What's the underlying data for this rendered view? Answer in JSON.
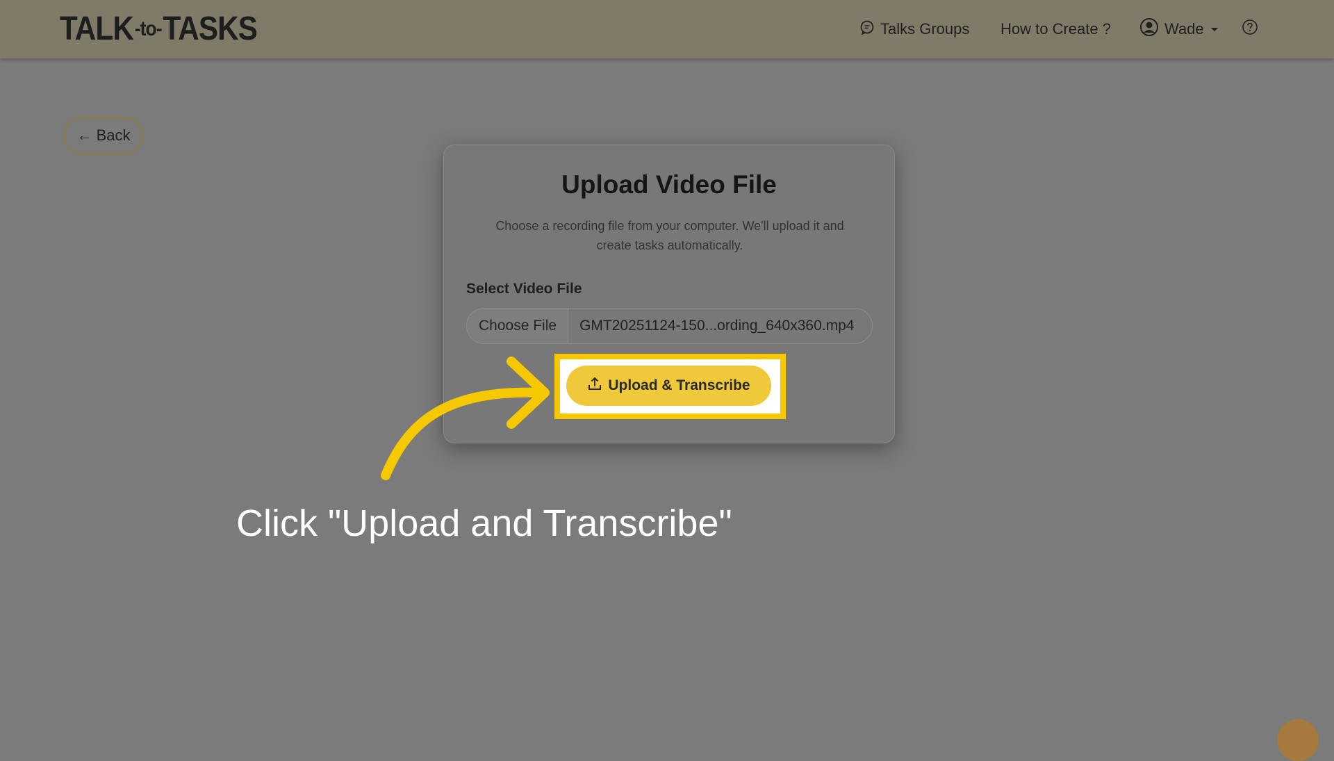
{
  "navbar": {
    "brand_left": "TALK",
    "brand_mid": "-to-",
    "brand_right": "TASKS",
    "talks_groups": "Talks Groups",
    "how_to_create": "How to Create ?",
    "user_name": "Wade",
    "icons": {
      "groups": "chat-bubble-icon",
      "user": "user-circle-icon",
      "help": "question-circle-icon"
    }
  },
  "back_button": {
    "label": "← Back"
  },
  "card": {
    "title": "Upload Video File",
    "description": "Choose a recording file from your computer. We'll upload it and create tasks automatically.",
    "field_label": "Select Video File",
    "choose_file_label": "Choose File",
    "file_name": "GMT20251124-150...ording_640x360.mp4",
    "upload_button": "Upload & Transcribe"
  },
  "annotation": {
    "callout_text": "Click \"Upload and Transcribe\"",
    "highlight_color": "#f5c800"
  },
  "colors": {
    "accent": "#f0c93a",
    "overlay": "#7b7b7b"
  }
}
